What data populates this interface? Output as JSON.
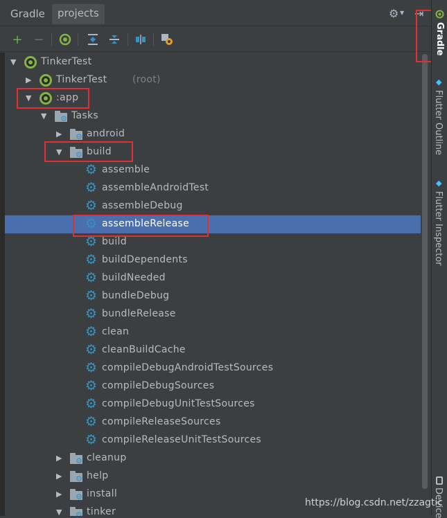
{
  "header": {
    "title": "Gradle",
    "tab": "projects"
  },
  "toolbar": {
    "add": "+",
    "remove": "−"
  },
  "tree": [
    {
      "label": "TinkerTest",
      "indent": 0,
      "icon": "gradle",
      "expanded": true
    },
    {
      "label": "TinkerTest",
      "suffix": "(root)",
      "indent": 1,
      "icon": "gradle",
      "expanded": false
    },
    {
      "label": ":app",
      "indent": 1,
      "icon": "gradle",
      "expanded": true
    },
    {
      "label": "Tasks",
      "indent": 2,
      "icon": "folder",
      "expanded": true
    },
    {
      "label": "android",
      "indent": 3,
      "icon": "folder",
      "expanded": false
    },
    {
      "label": "build",
      "indent": 3,
      "icon": "folder",
      "expanded": true
    },
    {
      "label": "assemble",
      "indent": 4,
      "icon": "gear"
    },
    {
      "label": "assembleAndroidTest",
      "indent": 4,
      "icon": "gear"
    },
    {
      "label": "assembleDebug",
      "indent": 4,
      "icon": "gear"
    },
    {
      "label": "assembleRelease",
      "indent": 4,
      "icon": "gear",
      "selected": true
    },
    {
      "label": "build",
      "indent": 4,
      "icon": "gear"
    },
    {
      "label": "buildDependents",
      "indent": 4,
      "icon": "gear"
    },
    {
      "label": "buildNeeded",
      "indent": 4,
      "icon": "gear"
    },
    {
      "label": "bundleDebug",
      "indent": 4,
      "icon": "gear"
    },
    {
      "label": "bundleRelease",
      "indent": 4,
      "icon": "gear"
    },
    {
      "label": "clean",
      "indent": 4,
      "icon": "gear"
    },
    {
      "label": "cleanBuildCache",
      "indent": 4,
      "icon": "gear"
    },
    {
      "label": "compileDebugAndroidTestSources",
      "indent": 4,
      "icon": "gear"
    },
    {
      "label": "compileDebugSources",
      "indent": 4,
      "icon": "gear"
    },
    {
      "label": "compileDebugUnitTestSources",
      "indent": 4,
      "icon": "gear"
    },
    {
      "label": "compileReleaseSources",
      "indent": 4,
      "icon": "gear"
    },
    {
      "label": "compileReleaseUnitTestSources",
      "indent": 4,
      "icon": "gear"
    },
    {
      "label": "cleanup",
      "indent": 3,
      "icon": "folder",
      "expanded": false
    },
    {
      "label": "help",
      "indent": 3,
      "icon": "folder",
      "expanded": false
    },
    {
      "label": "install",
      "indent": 3,
      "icon": "folder",
      "expanded": false
    },
    {
      "label": "tinker",
      "indent": 3,
      "icon": "folder",
      "expanded": true
    }
  ],
  "side_tabs": {
    "gradle": "Gradle",
    "outline": "Flutter Outline",
    "inspector": "Flutter Inspector",
    "device": "Device"
  },
  "watermark": "https://blog.csdn.net/zzagtic",
  "colors": {
    "background": "#3c3f41",
    "selection": "#4b6eaf",
    "gear": "#3592c4",
    "gradle_green": "#82b541",
    "highlight": "#e03030"
  }
}
